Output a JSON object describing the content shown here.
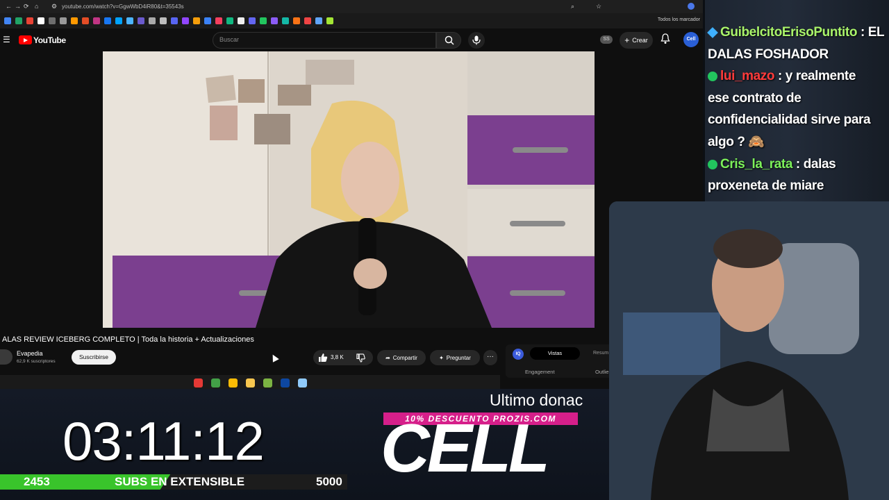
{
  "browser": {
    "url": "youtube.com/watch?v=GgwWbD4iR80&t=35543s",
    "bookmarks_all_label": "Todos los marcador",
    "bookmark_colors": [
      "#4285f4",
      "#21a366",
      "#ea4335",
      "#ffffff",
      "#6e6e6e",
      "#999999",
      "#ff9900",
      "#e44d26",
      "#c13584",
      "#1877f2",
      "#00a3ff",
      "#4cb5ff",
      "#6a5acd",
      "#aaaaaa",
      "#bdbdbd",
      "#5865f2",
      "#9146ff",
      "#f59e0b",
      "#3b82f6",
      "#f43f5e",
      "#10b981",
      "#eeeeee",
      "#6366f1",
      "#22c55e",
      "#8b5cf6",
      "#14b8a6",
      "#f97316",
      "#ef4444",
      "#60a5fa",
      "#a3e635"
    ]
  },
  "youtube": {
    "logo_text": "YouTube",
    "search_placeholder": "Buscar",
    "ss_badge": "SS",
    "create_label": "Crear",
    "avatar_label": "Cell",
    "video_title": "ALAS REVIEW ICEBERG COMPLETO | Toda la historia + Actualizaciones",
    "channel_name": "Evapedia",
    "channel_subs": "62,9 K suscriptores",
    "subscribe_label": "Suscribirse",
    "like_count": "3,8 K",
    "share_label": "Compartir",
    "ask_label": "Preguntar",
    "more_label": "···",
    "extension": {
      "icon_label": "IQ",
      "tab_active": "Vistas",
      "tab_2": "Resum",
      "label_1": "Engagement",
      "label_2": "Outlie"
    }
  },
  "taskbar": {
    "icon_colors": [
      "#e53935",
      "#43a047",
      "#fbbc05",
      "#f9c74f",
      "#7cb342",
      "#0d47a1",
      "#90caf9"
    ]
  },
  "chat": {
    "lines": [
      {
        "user": "GuibelcitoErisoPuntito",
        "user_color": "#a9f36a",
        "text": ": EL"
      },
      {
        "user": "",
        "user_color": "#ffffff",
        "text": "DALAS FOSHADOR"
      },
      {
        "user": "lui_mazo",
        "user_color": "#ff3b3b",
        "text": ": y realmente"
      },
      {
        "user": "",
        "user_color": "#ffffff",
        "text": "ese contrato de"
      },
      {
        "user": "",
        "user_color": "#ffffff",
        "text": "confidencialidad sirve para"
      },
      {
        "user": "",
        "user_color": "#ffffff",
        "text": "algo ? 🙈"
      },
      {
        "user": "Cris_la_rata",
        "user_color": "#7cf05a",
        "text": ": dalas"
      },
      {
        "user": "",
        "user_color": "#ffffff",
        "text": "proxeneta de miare"
      }
    ]
  },
  "overlay": {
    "timer": "03:11:12",
    "progress_current": "2453",
    "progress_label": "SUBS EN EXTENSIBLE",
    "progress_goal": "5000",
    "progress_fraction": 0.4906,
    "last_donation_label": "Ultimo donac",
    "promo": "10% DESCUENTO PROZIS.COM",
    "donor_name": "CELL"
  },
  "colors": {
    "accent_red": "#ff0000",
    "progress_green": "#39c42b",
    "promo_pink": "#d61f8a"
  }
}
